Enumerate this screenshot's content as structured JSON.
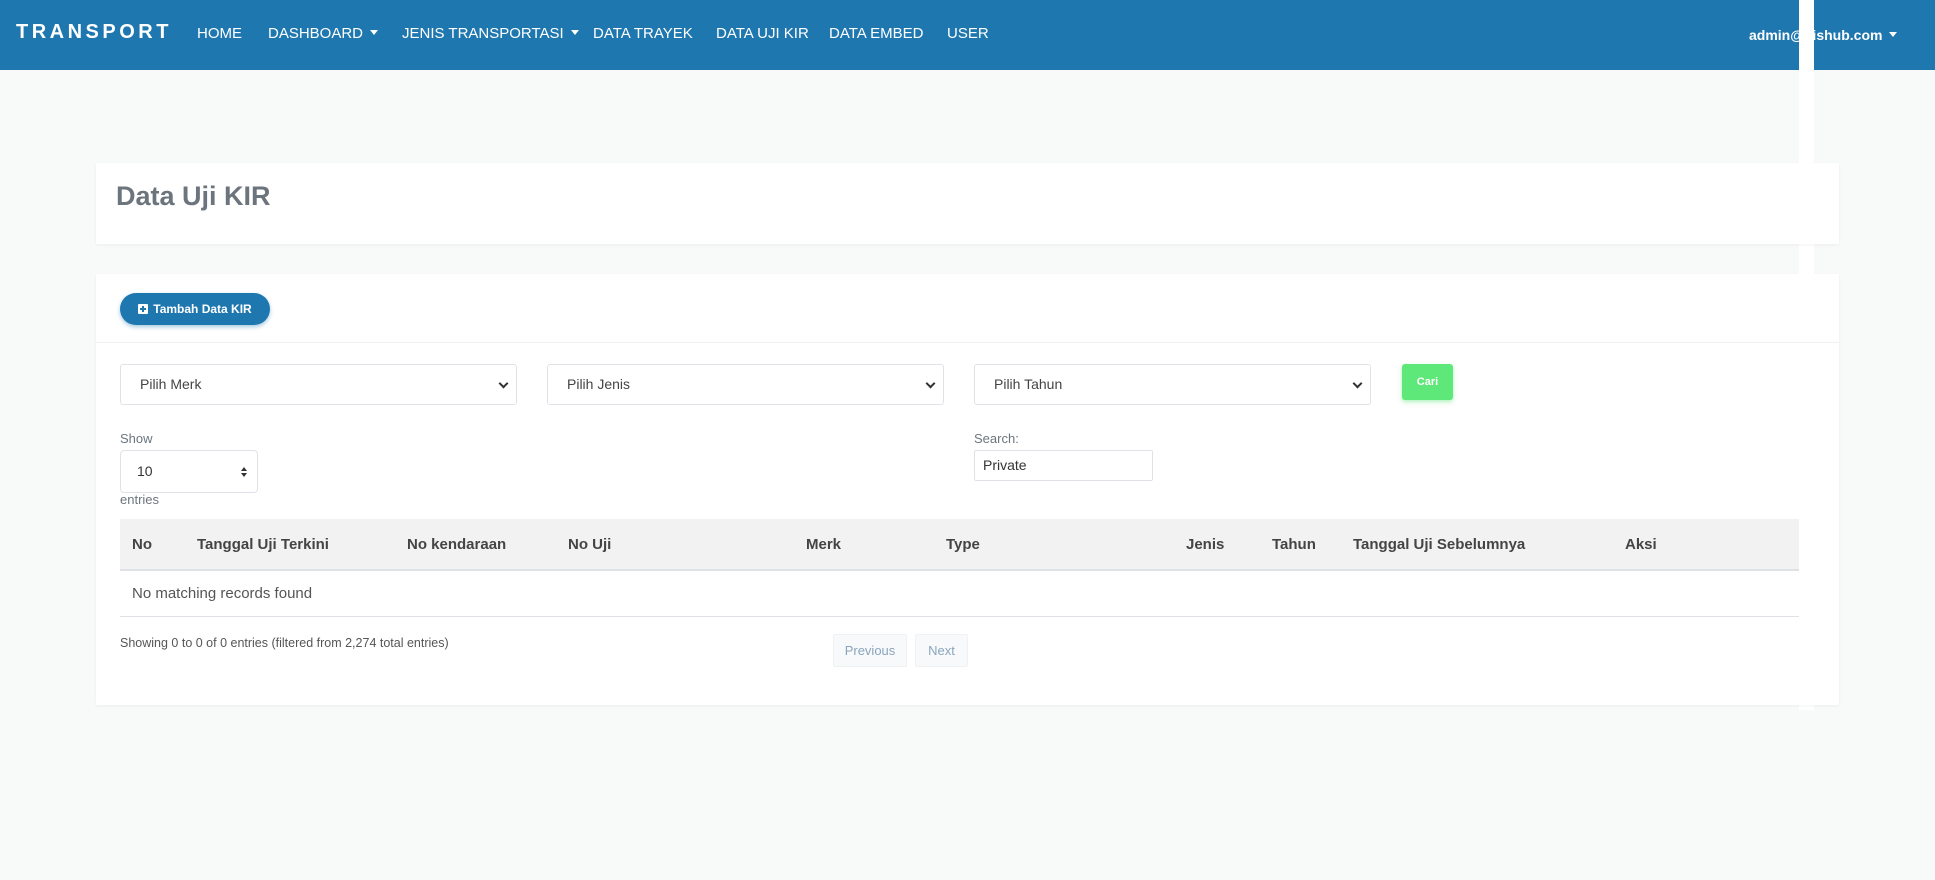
{
  "navbar": {
    "brand": "TRANSPORT",
    "items": [
      {
        "label": "HOME"
      },
      {
        "label": "DASHBOARD"
      },
      {
        "label": "JENIS TRANSPORTASI"
      },
      {
        "label": "DATA TRAYEK"
      },
      {
        "label": "DATA UJI KIR"
      },
      {
        "label": "DATA EMBED"
      },
      {
        "label": "USER"
      }
    ],
    "user": "admin@dishub.com",
    "color": "#1f77b0"
  },
  "page": {
    "title": "Data Uji KIR"
  },
  "toolbar": {
    "add_label": "Tambah Data KIR",
    "add_icon": "plus-square-icon"
  },
  "filters": {
    "merk": "Pilih Merk",
    "jenis": "Pilih Jenis",
    "tahun": "Pilih Tahun",
    "search_button": "Cari",
    "search_button_color": "#5fe87a"
  },
  "table_controls": {
    "show_label": "Show",
    "entries_value": "10",
    "entries_label": "entries",
    "search_label": "Search:",
    "search_value": "Private"
  },
  "table": {
    "columns": [
      "No",
      "Tanggal Uji Terkini",
      "No kendaraan",
      "No Uji",
      "Merk",
      "Type",
      "Jenis",
      "Tahun",
      "Tanggal Uji Sebelumnya",
      "Aksi"
    ],
    "empty_message": "No matching records found"
  },
  "footer": {
    "info": "Showing 0 to 0 of 0 entries (filtered from 2,274 total entries)",
    "previous": "Previous",
    "next": "Next"
  }
}
